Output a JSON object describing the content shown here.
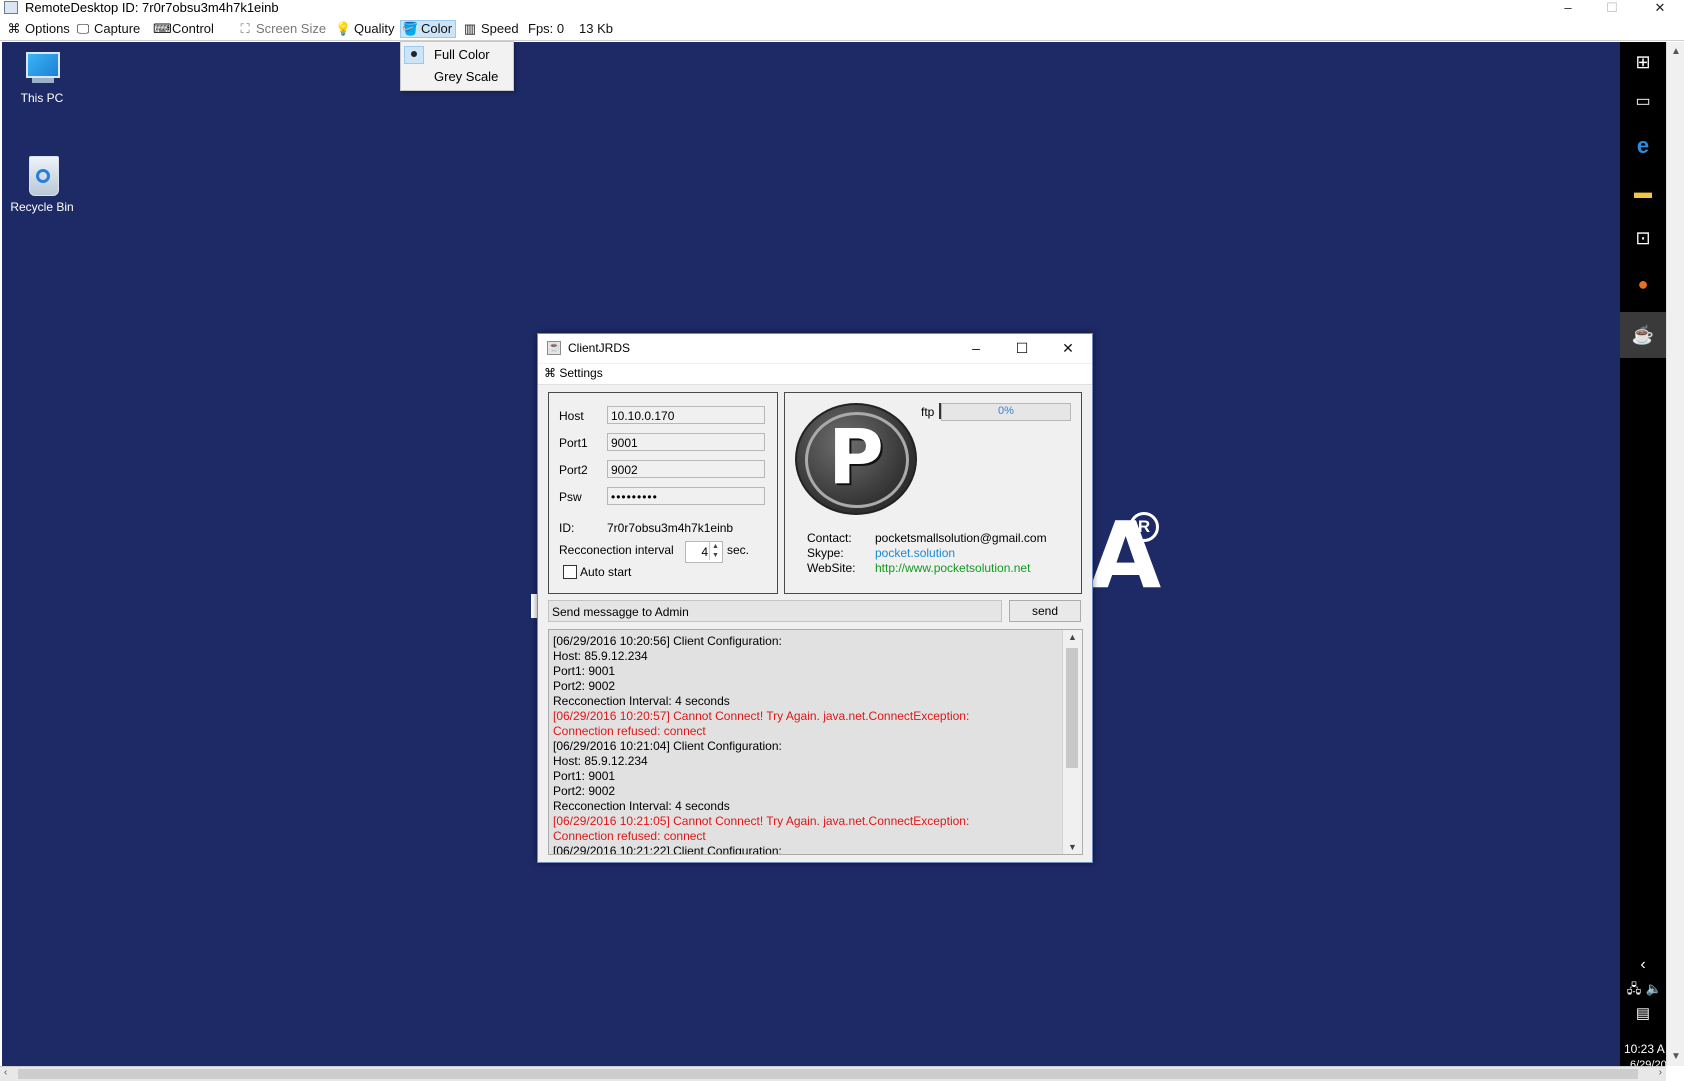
{
  "outer": {
    "title": "RemoteDesktop ID: 7r0r7obsu3m4h7k1einb",
    "window_buttons": {
      "minimize": "–",
      "maximize": "☐",
      "close": "✕"
    }
  },
  "menubar": {
    "items": [
      {
        "label": "Options",
        "icon": "options-icon",
        "glyph": "⌘"
      },
      {
        "label": "Capture",
        "icon": "monitor-icon",
        "glyph": "🖵"
      },
      {
        "label": "Control",
        "icon": "keyboard-icon",
        "glyph": "⌨"
      },
      {
        "label": "Screen Size",
        "icon": "screen-size-icon",
        "glyph": "⛶"
      },
      {
        "label": "Quality",
        "icon": "lightbulb-icon",
        "glyph": "💡"
      },
      {
        "label": "Color",
        "icon": "paint-bucket-icon",
        "glyph": "🪣"
      },
      {
        "label": "Speed",
        "icon": "speed-icon",
        "glyph": "▥"
      }
    ],
    "fps": "Fps: 0",
    "size": "13 Kb"
  },
  "color_menu": {
    "items": [
      {
        "label": "Full Color",
        "checked": true
      },
      {
        "label": "Grey Scale",
        "checked": false
      }
    ]
  },
  "desktop": {
    "icons": [
      {
        "label": "This PC",
        "icon": "this-pc-icon"
      },
      {
        "label": "Recycle Bin",
        "icon": "recycle-bin-icon"
      }
    ],
    "background_color": "#1e2a66"
  },
  "taskbar": {
    "icons": [
      "windows-start-icon",
      "task-view-icon",
      "edge-icon",
      "file-explorer-icon",
      "store-icon",
      "firefox-icon",
      "java-app-icon"
    ],
    "chevron": "‹",
    "clock": "10:23 A",
    "date": "6/29/20"
  },
  "client": {
    "title": "ClientJRDS",
    "menu": "Settings",
    "fields": {
      "host_label": "Host",
      "host": "10.10.0.170",
      "port1_label": "Port1",
      "port1": "9001",
      "port2_label": "Port2",
      "port2": "9002",
      "psw_label": "Psw",
      "psw": "•••••••••",
      "id_label": "ID:",
      "id": "7r0r7obsu3m4h7k1einb",
      "interval_label": "Recconection interval",
      "interval": "4",
      "interval_unit": "sec.",
      "autostart_label": "Auto start",
      "autostart": false
    },
    "info": {
      "logo_letter": "P",
      "ftp_label": "ftp",
      "ftp_progress": "0%",
      "ftp_fraction": 0,
      "contact_label": "Contact:",
      "contact": "pocketsmallsolution@gmail.com",
      "skype_label": "Skype:",
      "skype": "pocket.solution",
      "website_label": "WebSite:",
      "website": "http://www.pocketsolution.net"
    },
    "message_placeholder": "Send messagge to Admin",
    "send_label": "send",
    "log": [
      {
        "text": "[06/29/2016 10:20:56] Client Configuration:",
        "error": false
      },
      {
        "text": "Host: 85.9.12.234",
        "error": false
      },
      {
        "text": "Port1: 9001",
        "error": false
      },
      {
        "text": "Port2: 9002",
        "error": false
      },
      {
        "text": "Recconection Interval: 4 seconds",
        "error": false
      },
      {
        "text": "[06/29/2016 10:20:57] Cannot Connect! Try Again. java.net.ConnectException:",
        "error": true
      },
      {
        "text": "Connection refused: connect",
        "error": true
      },
      {
        "text": "[06/29/2016 10:21:04] Client Configuration:",
        "error": false
      },
      {
        "text": "Host: 85.9.12.234",
        "error": false
      },
      {
        "text": "Port1: 9001",
        "error": false
      },
      {
        "text": "Port2: 9002",
        "error": false
      },
      {
        "text": "Recconection Interval: 4 seconds",
        "error": false
      },
      {
        "text": "[06/29/2016 10:21:05] Cannot Connect! Try Again. java.net.ConnectException:",
        "error": true
      },
      {
        "text": "Connection refused: connect",
        "error": true
      },
      {
        "text": "[06/29/2016 10:21:22] Client Configuration:",
        "error": false
      }
    ]
  }
}
